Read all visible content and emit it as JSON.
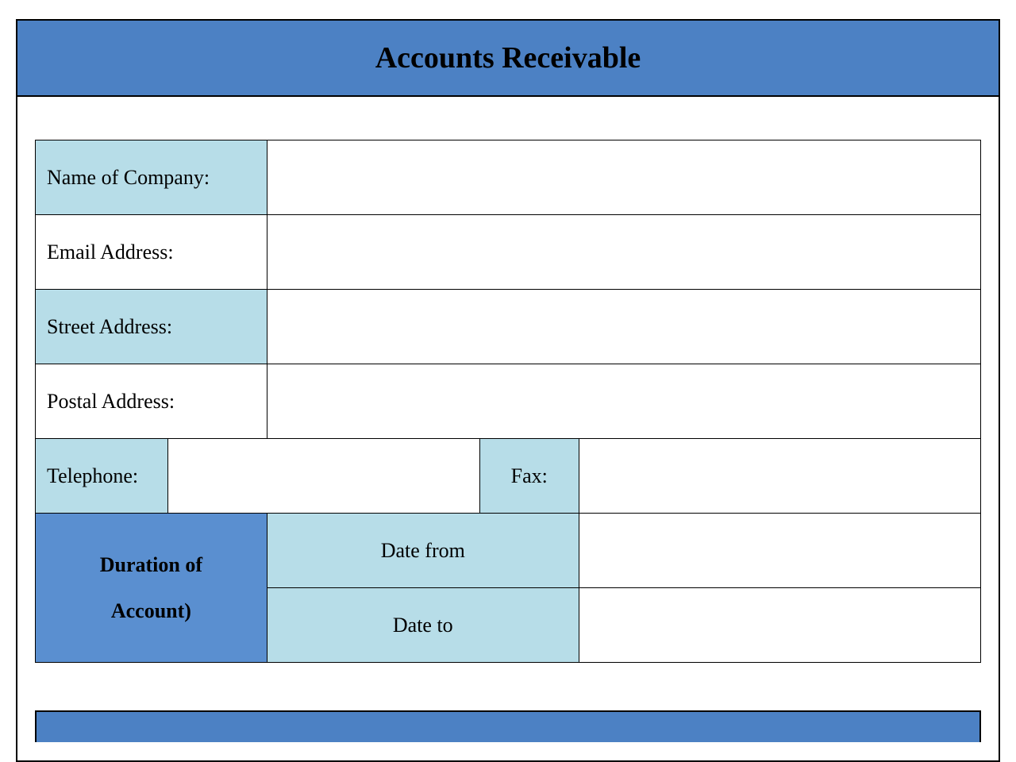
{
  "header": {
    "title": "Accounts Receivable"
  },
  "fields": {
    "company_name_label": "Name of Company:",
    "company_name_value": "",
    "email_label": "Email Address:",
    "email_value": "",
    "street_label": "Street Address:",
    "street_value": "",
    "postal_label": "Postal Address:",
    "postal_value": "",
    "telephone_label": "Telephone:",
    "telephone_value": "",
    "fax_label": "Fax:",
    "fax_value": "",
    "duration_label_line1": "Duration of",
    "duration_label_line2": "Account)",
    "date_from_label": "Date from",
    "date_from_value": "",
    "date_to_label": "Date to",
    "date_to_value": ""
  }
}
